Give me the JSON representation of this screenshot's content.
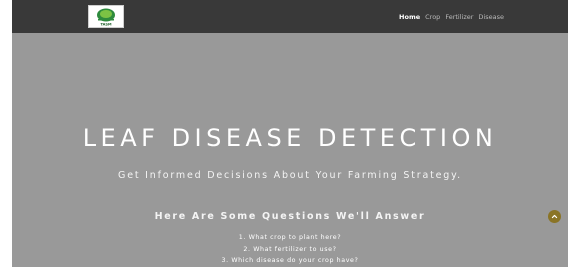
{
  "brand": {
    "logo_text": "TASM"
  },
  "nav": {
    "items": [
      {
        "label": "Home",
        "active": true
      },
      {
        "label": "Crop",
        "active": false
      },
      {
        "label": "Fertilizer",
        "active": false
      },
      {
        "label": "Disease",
        "active": false
      }
    ]
  },
  "hero": {
    "title": "LEAF DISEASE DETECTION",
    "subtitle": "Get Informed Decisions About Your Farming Strategy.",
    "questions_heading": "Here Are Some Questions We'll Answer",
    "questions": [
      "1. What crop to plant here?",
      "2. What fertilizer to use?",
      "3. Which disease do your crop have?"
    ]
  },
  "colors": {
    "navbar": "#393939",
    "hero_overlay": "#999999",
    "scroll_button": "#8a7426"
  },
  "icons": {
    "scroll_top": "chevron-up-icon"
  }
}
